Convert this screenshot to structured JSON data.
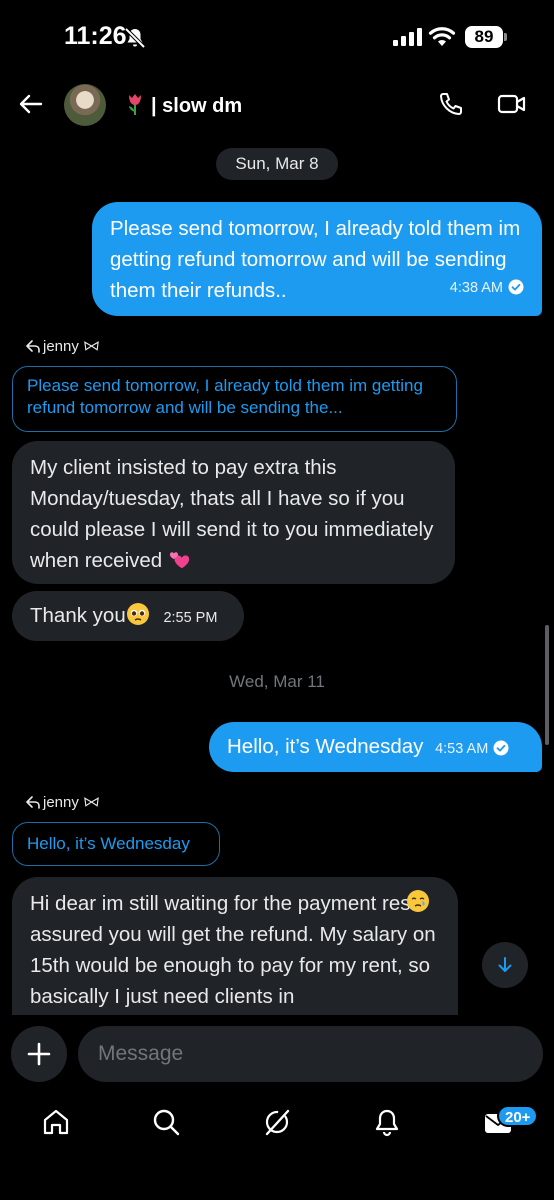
{
  "status": {
    "time": "11:26",
    "battery": "89"
  },
  "header": {
    "title": "| slow dm"
  },
  "thread": {
    "date1": "Sun, Mar 8",
    "msg1": {
      "text": "Please send tomorrow, I already told them im getting refund tomorrow and will be sending them their refunds..",
      "time": "4:38 AM"
    },
    "reply1": {
      "label": "jenny ",
      "quote": "Please send tomorrow, I already told them im getting refund tomorrow and will be sending the..."
    },
    "msg2": {
      "text": "My client insisted to pay extra this Monday/tuesday, thats all I have so if you could please I will send it to you immediately when received "
    },
    "msg3": {
      "text": "Thank you",
      "time": "2:55 PM"
    },
    "date2": "Wed, Mar 11",
    "msg4": {
      "text": "Hello, it’s Wednesday",
      "time": "4:53 AM"
    },
    "reply2": {
      "label": "jenny ",
      "quote": "Hello, it’s Wednesday"
    },
    "msg5": {
      "text": "Hi dear im still waiting for the payment rest assured you will get the refund. My salary on 15th would be enough to pay for my rent, so basically I just need clients in"
    }
  },
  "composer": {
    "placeholder": "Message"
  },
  "tabbar": {
    "badge": "20+"
  },
  "colors": {
    "accent": "#1d9bf0",
    "bubble_in": "#202327",
    "background": "#000000"
  }
}
